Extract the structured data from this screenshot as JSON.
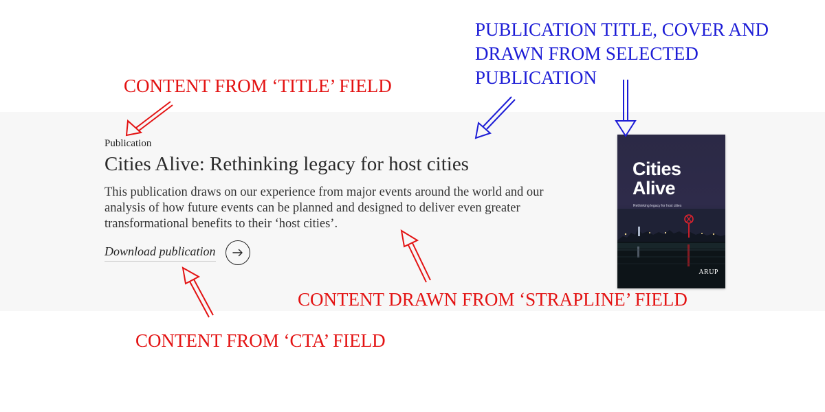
{
  "publication": {
    "eyebrow": "Publication",
    "title": "Cities Alive: Rethinking legacy for host cities",
    "strapline": "This publication draws on our experience from major events around the world and our analysis of how future events can be planned and designed to deliver even greater transformational benefits to their ‘host cities’.",
    "cta_label": "Download publication",
    "cta_icon": "arrow-right-icon"
  },
  "cover": {
    "title_line1": "Cities",
    "title_line2": "Alive",
    "subtitle": "Rethinking legacy for host cities",
    "logo_text": "ARUP"
  },
  "annotations": {
    "title_field": "CONTENT FROM ‘TITLE’ FIELD",
    "publication_line1": "PUBLICATION TITLE, COVER AND",
    "publication_line2": "DRAWN FROM SELECTED",
    "publication_line3": "PUBLICATION",
    "strapline_field": "CONTENT DRAWN FROM ‘STRAPLINE’ FIELD",
    "cta_field": "CONTENT FROM ‘CTA’ FIELD"
  },
  "colors": {
    "annotation_red": "#e31212",
    "annotation_blue": "#1c1cd6",
    "band_background": "#f7f7f7",
    "cover_background": "#2b2945"
  }
}
